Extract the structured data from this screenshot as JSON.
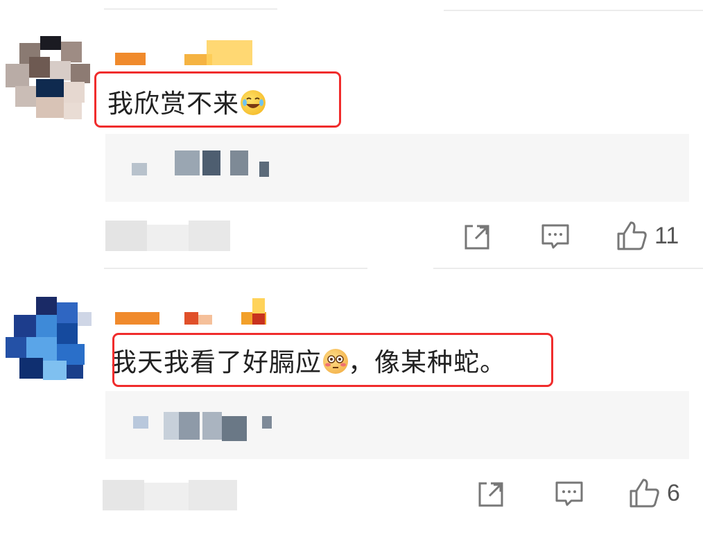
{
  "comments": [
    {
      "text": "我欣赏不来",
      "emoji": "rolling-on-floor-laughing-emoji",
      "likes": "11"
    },
    {
      "text": "我天我看了好膈应",
      "emoji": "flushed-face-emoji",
      "text_after": "，像某种蛇。",
      "likes": "6"
    }
  ],
  "colors": {
    "highlight": "#f02c2c",
    "reply_bg": "#f6f6f6",
    "icon": "#777777"
  }
}
